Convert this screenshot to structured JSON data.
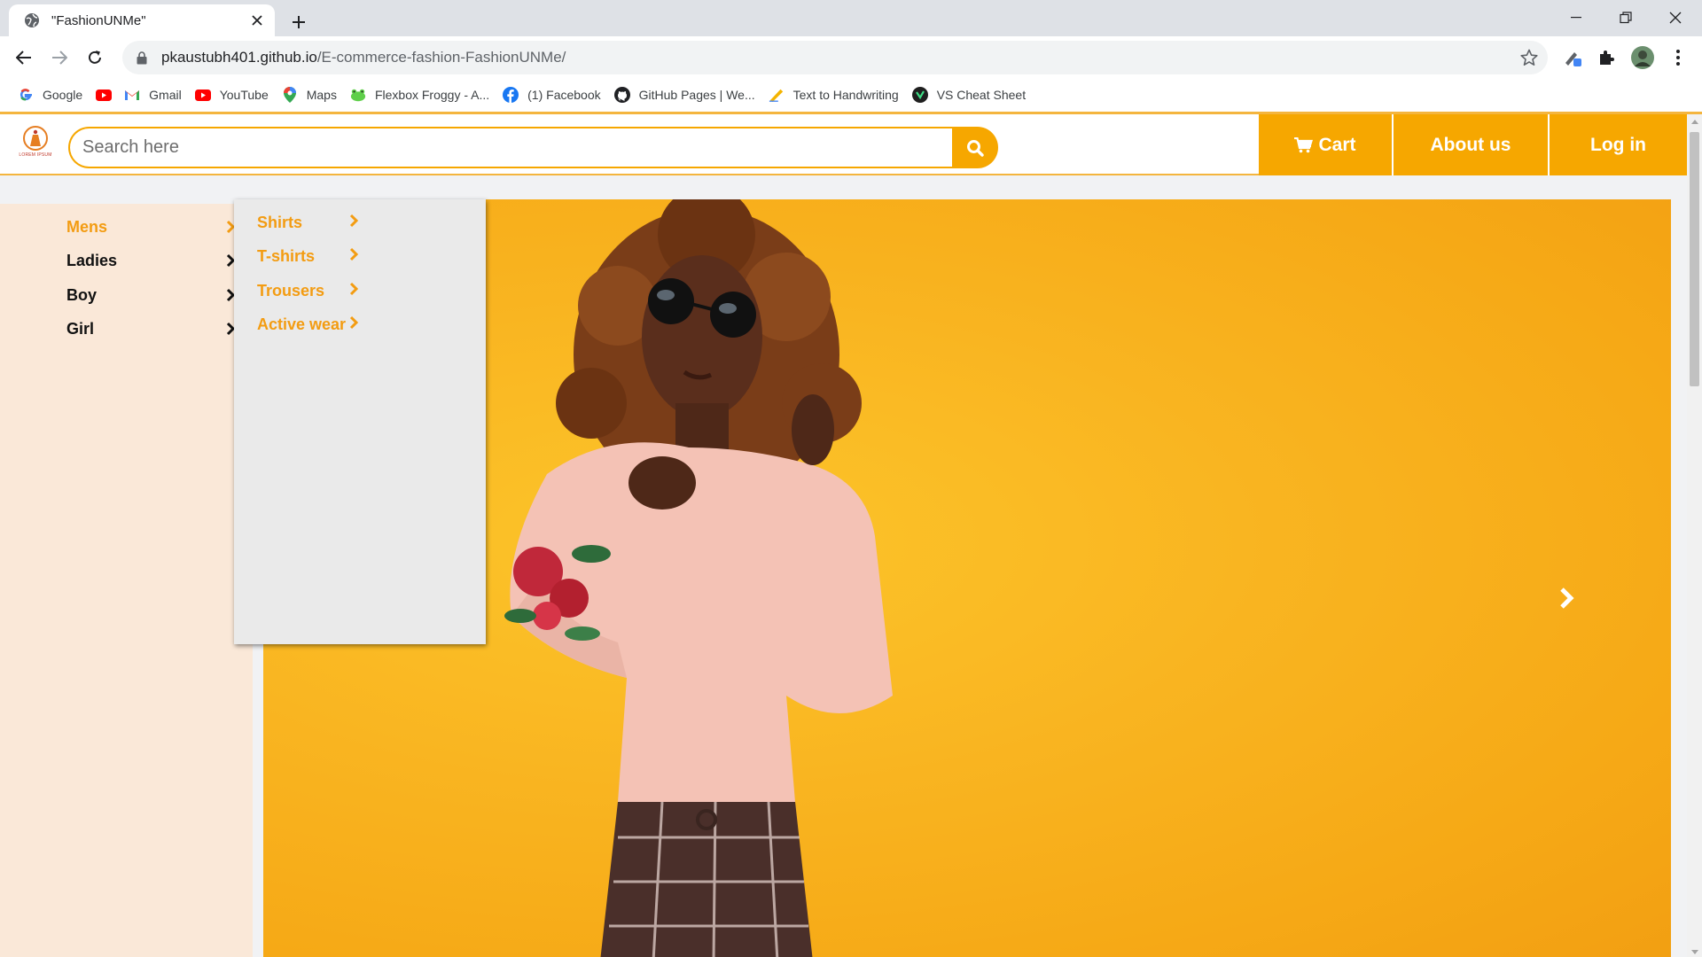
{
  "browser": {
    "tab_title": "\"FashionUNMe\"",
    "url_host": "pkaustubh401.github.io",
    "url_path": "/E-commerce-fashion-FashionUNMe/",
    "bookmarks": [
      {
        "label": "Google",
        "icon": "google-icon"
      },
      {
        "label": "",
        "icon": "youtube-icon"
      },
      {
        "label": "Gmail",
        "icon": "gmail-icon"
      },
      {
        "label": "YouTube",
        "icon": "youtube-icon"
      },
      {
        "label": "Maps",
        "icon": "maps-icon"
      },
      {
        "label": "Flexbox Froggy - A...",
        "icon": "frog-icon"
      },
      {
        "label": "(1) Facebook",
        "icon": "facebook-icon"
      },
      {
        "label": "GitHub Pages | We...",
        "icon": "github-icon"
      },
      {
        "label": "Text to Handwriting",
        "icon": "pen-icon"
      },
      {
        "label": "VS Cheat Sheet",
        "icon": "vs-icon"
      }
    ]
  },
  "site": {
    "logo_text": "LOREM IPSUM",
    "search_placeholder": "Search here",
    "nav": {
      "cart": "Cart",
      "about": "About us",
      "login": "Log in"
    },
    "categories": [
      {
        "label": "Mens",
        "active": true
      },
      {
        "label": "Ladies",
        "active": false
      },
      {
        "label": "Boy",
        "active": false
      },
      {
        "label": "Girl",
        "active": false
      }
    ],
    "submenu": [
      {
        "label": "Shirts"
      },
      {
        "label": "T-shirts"
      },
      {
        "label": "Trousers"
      },
      {
        "label": "Active wear"
      }
    ]
  },
  "colors": {
    "accent": "#f6a700",
    "active_text": "#f39c12",
    "sidebar_bg": "#fae8d8",
    "submenu_bg": "#eaeaea",
    "hero_bg": "#f9b521"
  }
}
